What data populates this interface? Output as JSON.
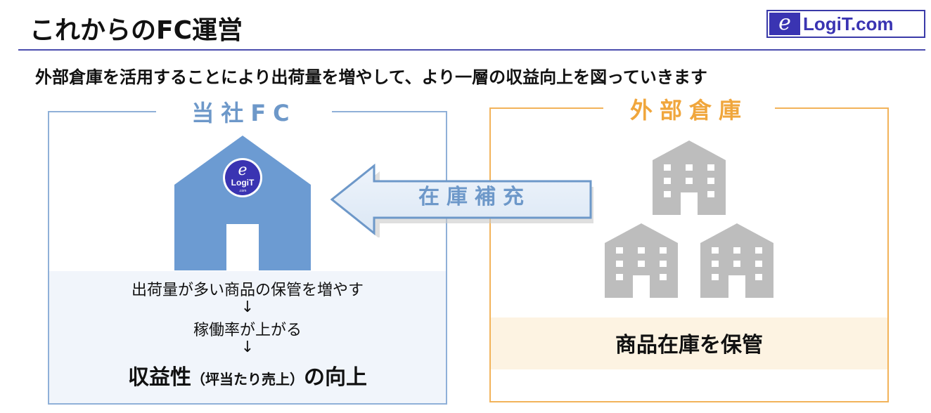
{
  "header": {
    "title": "これからのFC運営",
    "logo_mark": "e",
    "logo_text": "LogiT.com"
  },
  "subtitle": "外部倉庫を活用することにより出荷量を増やして、より一層の収益向上を図っていきます",
  "fc": {
    "label": "当社FC",
    "house_logo_mark": "e",
    "house_logo_text": "LogiT",
    "house_logo_sub": ".com",
    "line1": "出荷量が多い商品の保管を増やす",
    "arrow1": "↓",
    "line2": "稼働率が上がる",
    "arrow2": "↓",
    "line3_main": "収益性",
    "line3_small": "（坪当たり売上）",
    "line3_end": "の向上"
  },
  "flow": {
    "label": "在庫補充"
  },
  "warehouse": {
    "label": "外部倉庫",
    "caption": "商品在庫を保管"
  },
  "colors": {
    "accent_blue": "#6d98c9",
    "house_blue": "#6c9bd2",
    "accent_orange": "#f0a63c",
    "rule_purple": "#4b4dae",
    "building_gray": "#bdbdbd"
  }
}
